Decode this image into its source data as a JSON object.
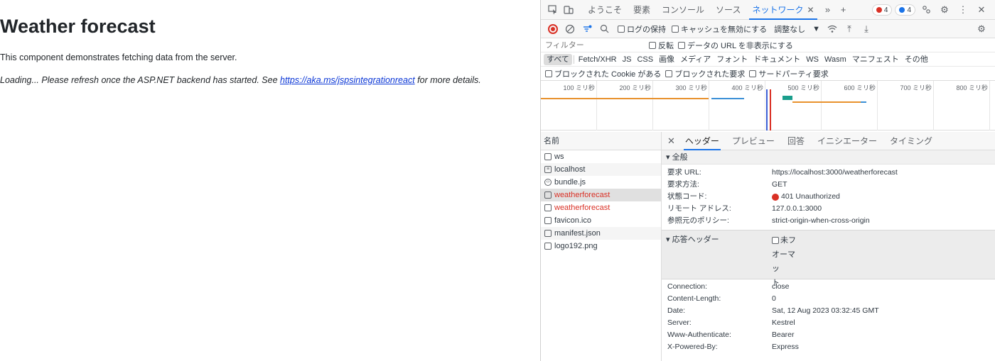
{
  "page": {
    "heading": "Weather forecast",
    "description": "This component demonstrates fetching data from the server.",
    "loading_prefix": "Loading... Please refresh once the ASP.NET backend has started. See ",
    "loading_link": "https://aka.ms/jspsintegrationreact",
    "loading_suffix": " for more details."
  },
  "devtools": {
    "tabs": [
      "ようこそ",
      "要素",
      "コンソール",
      "ソース",
      "ネットワーク"
    ],
    "active_tab": "ネットワーク",
    "error_count": "4",
    "message_count": "4",
    "toolbar": {
      "preserve_log": "ログの保持",
      "disable_cache": "キャッシュを無効にする",
      "throttle": "調整なし"
    },
    "filter": {
      "placeholder": "フィルター",
      "invert": "反転",
      "hide_data_urls": "データの URL を非表示にする"
    },
    "types": [
      "すべて",
      "Fetch/XHR",
      "JS",
      "CSS",
      "画像",
      "メディア",
      "フォント",
      "ドキュメント",
      "WS",
      "Wasm",
      "マニフェスト",
      "その他"
    ],
    "blocked": {
      "blocked_cookies": "ブロックされた Cookie がある",
      "blocked_requests": "ブロックされた要求",
      "third_party": "サードパーティ要求"
    },
    "timeline_ticks": [
      "100 ミリ秒",
      "200 ミリ秒",
      "300 ミリ秒",
      "400 ミリ秒",
      "500 ミリ秒",
      "600 ミリ秒",
      "700 ミリ秒",
      "800 ミリ秒"
    ],
    "name_header": "名前",
    "requests": [
      {
        "name": "ws",
        "icon": "file-icon",
        "error": false
      },
      {
        "name": "localhost",
        "icon": "document-icon",
        "error": false
      },
      {
        "name": "bundle.js",
        "icon": "script-icon",
        "error": false
      },
      {
        "name": "weatherforecast",
        "icon": "file-icon",
        "error": true
      },
      {
        "name": "weatherforecast",
        "icon": "file-icon",
        "error": true
      },
      {
        "name": "favicon.ico",
        "icon": "file-icon",
        "error": false
      },
      {
        "name": "manifest.json",
        "icon": "file-icon",
        "error": false
      },
      {
        "name": "logo192.png",
        "icon": "file-icon",
        "error": false
      }
    ],
    "detail_tabs": [
      "ヘッダー",
      "プレビュー",
      "回答",
      "イニシエーター",
      "タイミング"
    ],
    "general": {
      "title": "▾ 全般",
      "rows": [
        {
          "k": "要求 URL:",
          "v": "https://localhost:3000/weatherforecast"
        },
        {
          "k": "要求方法:",
          "v": "GET"
        },
        {
          "k": "状態コード:",
          "v": "401 Unauthorized"
        },
        {
          "k": "リモート アドレス:",
          "v": "127.0.0.1:3000"
        },
        {
          "k": "参照元のポリシー:",
          "v": "strict-origin-when-cross-origin"
        }
      ]
    },
    "response_headers": {
      "title": "▾ 応答ヘッダー",
      "raw_lines": [
        "未フ",
        "オーマッ",
        "ト"
      ],
      "rows": [
        {
          "k": "Connection:",
          "v": "close"
        },
        {
          "k": "Content-Length:",
          "v": "0"
        },
        {
          "k": "Date:",
          "v": "Sat, 12 Aug 2023 03:32:45 GMT"
        },
        {
          "k": "Server:",
          "v": "Kestrel"
        },
        {
          "k": "Www-Authenticate:",
          "v": "Bearer"
        },
        {
          "k": "X-Powered-By:",
          "v": "Express"
        }
      ]
    },
    "colors": {
      "accent": "#1a73e8",
      "error": "#d93025",
      "bar_orange": "#e8912d",
      "bar_blue": "#3b8fd6"
    }
  }
}
